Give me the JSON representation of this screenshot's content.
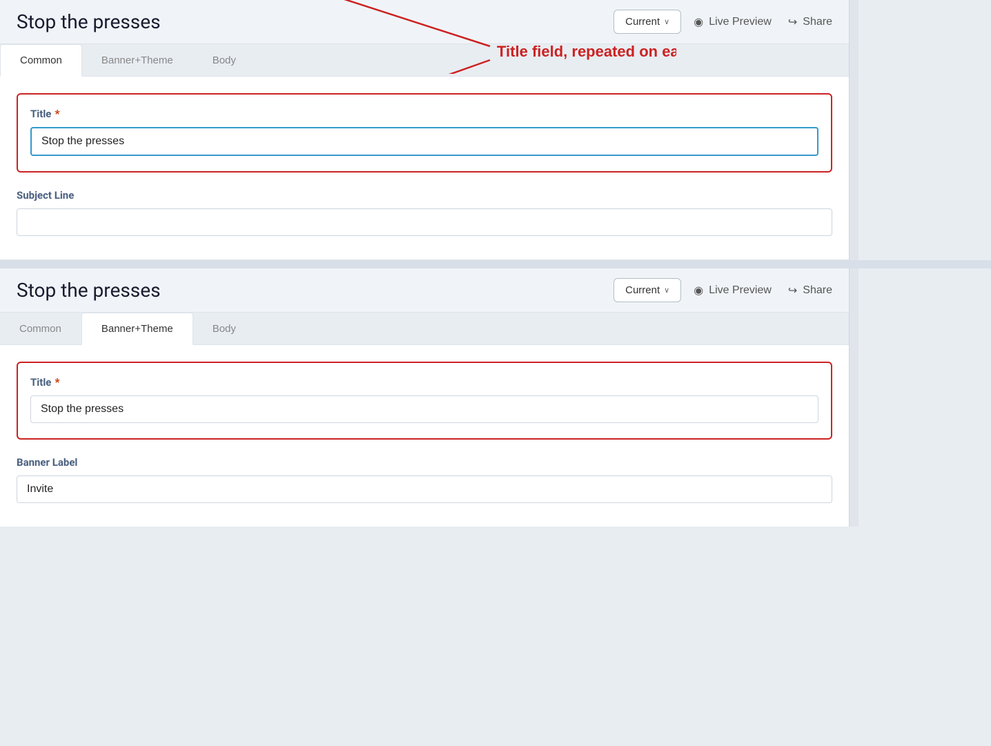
{
  "header1": {
    "title": "Stop the presses",
    "current_label": "Current",
    "chevron": "∨",
    "live_preview_label": "Live Preview",
    "share_label": "Share"
  },
  "header2": {
    "title": "Stop the presses",
    "current_label": "Current",
    "chevron": "∨",
    "live_preview_label": "Live Preview",
    "share_label": "Share"
  },
  "tabs1": {
    "common": "Common",
    "banner_theme": "Banner+Theme",
    "body": "Body"
  },
  "tabs2": {
    "common": "Common",
    "banner_theme": "Banner+Theme",
    "body": "Body"
  },
  "panel1": {
    "title_label": "Title",
    "title_value": "Stop the presses",
    "subject_label": "Subject Line",
    "subject_value": "",
    "subject_placeholder": ""
  },
  "panel2": {
    "title_label": "Title",
    "title_value": "Stop the presses",
    "banner_label": "Banner Label",
    "banner_value": "Invite"
  },
  "annotation": {
    "text": "Title field, repeated on each tab"
  },
  "icons": {
    "eye": "◉",
    "share": "↪",
    "chevron_down": "∨"
  }
}
